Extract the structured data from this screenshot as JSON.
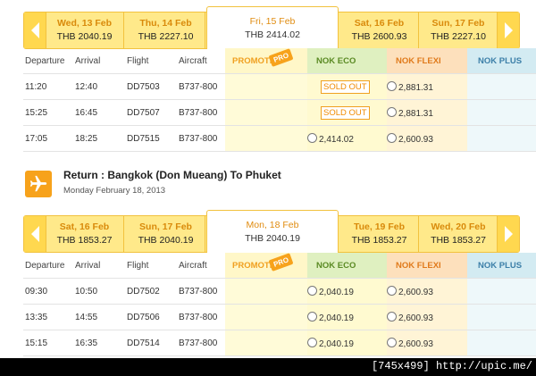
{
  "outbound": {
    "dates": [
      {
        "day": "Wed, 13 Feb",
        "price": "THB 2040.19"
      },
      {
        "day": "Thu, 14 Feb",
        "price": "THB 2227.10"
      },
      {
        "day": "Fri, 15 Feb",
        "price": "THB 2414.02"
      },
      {
        "day": "Sat, 16 Feb",
        "price": "THB 2600.93"
      },
      {
        "day": "Sun, 17 Feb",
        "price": "THB 2227.10"
      }
    ],
    "headers": {
      "departure": "Departure",
      "arrival": "Arrival",
      "flight": "Flight",
      "aircraft": "Aircraft",
      "promo": "PROMOTI",
      "promo_tag": "PRO",
      "eco": "NOK ECO",
      "flexi": "NOK FLEXI",
      "plus": "NOK PLUS"
    },
    "rows": [
      {
        "dep": "11:20",
        "arr": "12:40",
        "flight": "DD7503",
        "aircraft": "B737-800",
        "eco": "SOLD OUT",
        "flexi": "2,881.31"
      },
      {
        "dep": "15:25",
        "arr": "16:45",
        "flight": "DD7507",
        "aircraft": "B737-800",
        "eco": "SOLD OUT",
        "flexi": "2,881.31"
      },
      {
        "dep": "17:05",
        "arr": "18:25",
        "flight": "DD7515",
        "aircraft": "B737-800",
        "eco": "2,414.02",
        "flexi": "2,600.93"
      }
    ]
  },
  "return": {
    "title": "Return :  Bangkok (Don Mueang)  To  Phuket",
    "subtitle": "Monday February 18, 2013",
    "dates": [
      {
        "day": "Sat, 16 Feb",
        "price": "THB 1853.27"
      },
      {
        "day": "Sun, 17 Feb",
        "price": "THB 2040.19"
      },
      {
        "day": "Mon, 18 Feb",
        "price": "THB 2040.19"
      },
      {
        "day": "Tue, 19 Feb",
        "price": "THB 1853.27"
      },
      {
        "day": "Wed, 20 Feb",
        "price": "THB 1853.27"
      }
    ],
    "headers": {
      "departure": "Departure",
      "arrival": "Arrival",
      "flight": "Flight",
      "aircraft": "Aircraft",
      "promo": "PROMOTI",
      "promo_tag": "PRO",
      "eco": "NOK ECO",
      "flexi": "NOK FLEXI",
      "plus": "NOK PLUS"
    },
    "rows": [
      {
        "dep": "09:30",
        "arr": "10:50",
        "flight": "DD7502",
        "aircraft": "B737-800",
        "eco": "2,040.19",
        "flexi": "2,600.93"
      },
      {
        "dep": "13:35",
        "arr": "14:55",
        "flight": "DD7506",
        "aircraft": "B737-800",
        "eco": "2,040.19",
        "flexi": "2,600.93"
      },
      {
        "dep": "15:15",
        "arr": "16:35",
        "flight": "DD7514",
        "aircraft": "B737-800",
        "eco": "2,040.19",
        "flexi": "2,600.93"
      }
    ]
  },
  "footer": "[745x499] http://upic.me/",
  "colors": {
    "accent": "#f7a21b",
    "strip": "#ffe98a",
    "eco": "#dff0c0",
    "flexi": "#fde0bc",
    "plus": "#d3ebf2"
  },
  "icons": {
    "prev": "chevron-left-icon",
    "next": "chevron-right-icon",
    "plane": "airplane-icon"
  }
}
